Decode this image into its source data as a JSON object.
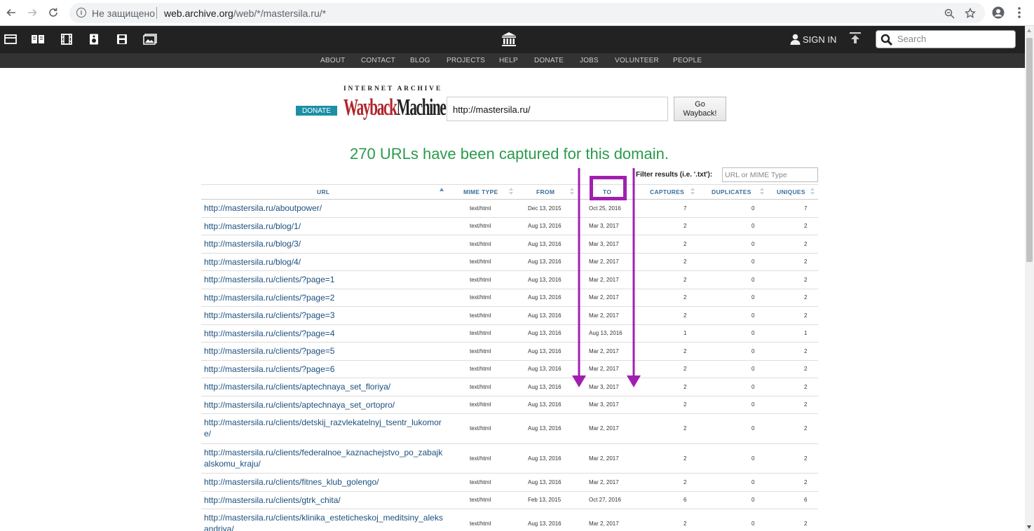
{
  "browser": {
    "insecure_label": "Не защищено",
    "url_host": "web.archive.org",
    "url_path": "/web/*/mastersila.ru/*"
  },
  "wayback": {
    "sign_in": "SIGN IN",
    "search_placeholder": "Search",
    "nav_items": [
      "ABOUT",
      "CONTACT",
      "BLOG",
      "PROJECTS",
      "HELP",
      "DONATE",
      "JOBS",
      "VOLUNTEER",
      "PEOPLE"
    ],
    "donate_button": "DONATE",
    "logo_top": "INTERNET ARCHIVE",
    "logo_wayback": "Wayback",
    "logo_machine": "Machine",
    "url_value": "http://mastersila.ru/",
    "go_line1": "Go",
    "go_line2": "Wayback!",
    "headline": "270 URLs have been captured for this domain.",
    "filter_label": "Filter results (i.e. '.txt'):",
    "filter_placeholder": "URL or MIME Type"
  },
  "table": {
    "headers": {
      "url": "URL",
      "mime": "MIME TYPE",
      "from": "FROM",
      "to": "TO",
      "captures": "CAPTURES",
      "duplicates": "DUPLICATES",
      "uniques": "UNIQUES"
    },
    "rows": [
      {
        "url": "http://mastersila.ru/aboutpower/",
        "mime": "text/html",
        "from": "Dec 13, 2015",
        "to": "Oct 25, 2016",
        "captures": "7",
        "duplicates": "0",
        "uniques": "7"
      },
      {
        "url": "http://mastersila.ru/blog/1/",
        "mime": "text/html",
        "from": "Aug 13, 2016",
        "to": "Mar 3, 2017",
        "captures": "2",
        "duplicates": "0",
        "uniques": "2"
      },
      {
        "url": "http://mastersila.ru/blog/3/",
        "mime": "text/html",
        "from": "Aug 13, 2016",
        "to": "Mar 3, 2017",
        "captures": "2",
        "duplicates": "0",
        "uniques": "2"
      },
      {
        "url": "http://mastersila.ru/blog/4/",
        "mime": "text/html",
        "from": "Aug 13, 2016",
        "to": "Mar 2, 2017",
        "captures": "2",
        "duplicates": "0",
        "uniques": "2"
      },
      {
        "url": "http://mastersila.ru/clients/?page=1",
        "mime": "text/html",
        "from": "Aug 13, 2016",
        "to": "Mar 2, 2017",
        "captures": "2",
        "duplicates": "0",
        "uniques": "2"
      },
      {
        "url": "http://mastersila.ru/clients/?page=2",
        "mime": "text/html",
        "from": "Aug 13, 2016",
        "to": "Mar 2, 2017",
        "captures": "2",
        "duplicates": "0",
        "uniques": "2"
      },
      {
        "url": "http://mastersila.ru/clients/?page=3",
        "mime": "text/html",
        "from": "Aug 13, 2016",
        "to": "Mar 2, 2017",
        "captures": "2",
        "duplicates": "0",
        "uniques": "2"
      },
      {
        "url": "http://mastersila.ru/clients/?page=4",
        "mime": "text/html",
        "from": "Aug 13, 2016",
        "to": "Aug 13, 2016",
        "captures": "1",
        "duplicates": "0",
        "uniques": "1"
      },
      {
        "url": "http://mastersila.ru/clients/?page=5",
        "mime": "text/html",
        "from": "Aug 13, 2016",
        "to": "Mar 2, 2017",
        "captures": "2",
        "duplicates": "0",
        "uniques": "2"
      },
      {
        "url": "http://mastersila.ru/clients/?page=6",
        "mime": "text/html",
        "from": "Aug 13, 2016",
        "to": "Mar 2, 2017",
        "captures": "2",
        "duplicates": "0",
        "uniques": "2"
      },
      {
        "url": "http://mastersila.ru/clients/aptechnaya_set_floriya/",
        "mime": "text/html",
        "from": "Aug 13, 2016",
        "to": "Mar 3, 2017",
        "captures": "2",
        "duplicates": "0",
        "uniques": "2"
      },
      {
        "url": "http://mastersila.ru/clients/aptechnaya_set_ortopro/",
        "mime": "text/html",
        "from": "Aug 13, 2016",
        "to": "Mar 3, 2017",
        "captures": "2",
        "duplicates": "0",
        "uniques": "2"
      },
      {
        "url": "http://mastersila.ru/clients/detskij_razvlekatelnyj_tsentr_lukomore/",
        "mime": "text/html",
        "from": "Aug 13, 2016",
        "to": "Mar 2, 2017",
        "captures": "2",
        "duplicates": "0",
        "uniques": "2"
      },
      {
        "url": "http://mastersila.ru/clients/federalnoe_kaznachejstvo_po_zabajkalskomu_kraju/",
        "mime": "text/html",
        "from": "Aug 13, 2016",
        "to": "Mar 2, 2017",
        "captures": "2",
        "duplicates": "0",
        "uniques": "2"
      },
      {
        "url": "http://mastersila.ru/clients/fitnes_klub_golengo/",
        "mime": "text/html",
        "from": "Aug 13, 2016",
        "to": "Mar 2, 2017",
        "captures": "2",
        "duplicates": "0",
        "uniques": "2"
      },
      {
        "url": "http://mastersila.ru/clients/gtrk_chita/",
        "mime": "text/html",
        "from": "Feb 13, 2015",
        "to": "Oct 27, 2016",
        "captures": "6",
        "duplicates": "0",
        "uniques": "6"
      },
      {
        "url": "http://mastersila.ru/clients/klinika_esteticheskoj_meditsiny_aleksandriya/",
        "mime": "text/html",
        "from": "Aug 13, 2016",
        "to": "Mar 2, 2017",
        "captures": "2",
        "duplicates": "0",
        "uniques": "2"
      }
    ]
  },
  "colors": {
    "accent_green": "#2a9b4b",
    "link_blue": "#1d4f7e",
    "annotation_purple": "#a11fb0"
  }
}
